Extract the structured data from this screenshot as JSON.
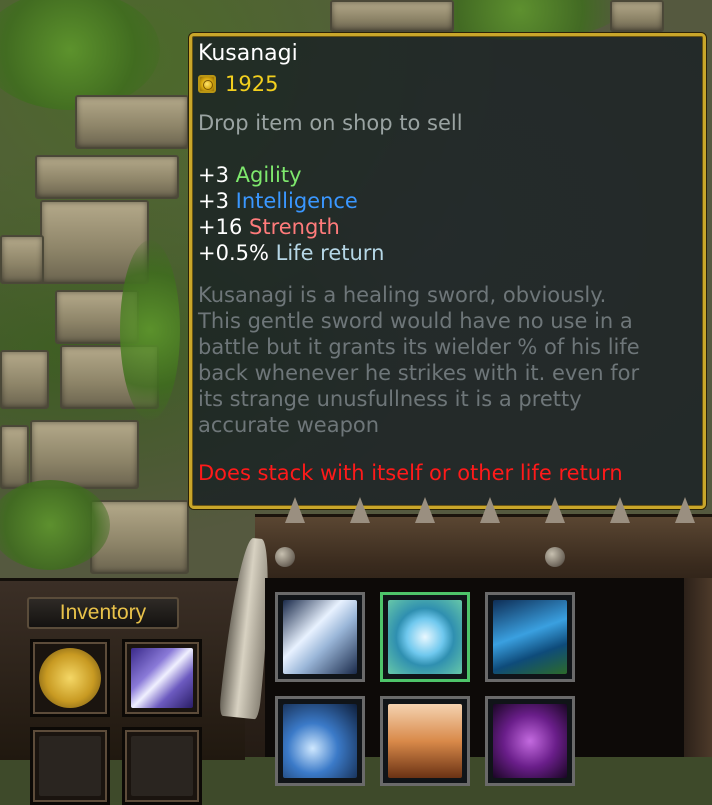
{
  "tooltip": {
    "title": "Kusanagi",
    "cost": "1925",
    "hint": "Drop item on shop to sell",
    "stats": [
      {
        "value": "+3",
        "name": "Agility"
      },
      {
        "value": "+3",
        "name": "Intelligence"
      },
      {
        "value": "+16",
        "name": "Strength"
      },
      {
        "value": "+0.5%",
        "name": "Life return"
      }
    ],
    "description": "Kusanagi is a  healing sword, obviously.\nThis gentle sword would have no use in a\nbattle but it grants its wielder % of his life\nback whenever he strikes with it. even for\nits strange unusfullness it is a pretty\naccurate weapon",
    "warning": "Does stack with itself or other life return"
  },
  "inventory": {
    "title": "Inventory",
    "slots": [
      {
        "icon": "gold-medallion-icon"
      },
      {
        "icon": "crystal-sword-icon"
      },
      {
        "icon": "empty-slot"
      },
      {
        "icon": "empty-slot"
      }
    ]
  },
  "commands": [
    {
      "icon": "white-blade-icon"
    },
    {
      "icon": "ice-ring-icon"
    },
    {
      "icon": "blue-crest-icon"
    },
    {
      "icon": "blue-swirl-icon"
    },
    {
      "icon": "fire-hammer-icon"
    },
    {
      "icon": "purple-orb-icon"
    }
  ],
  "colors": {
    "border_gold": "#c9a62a",
    "cost": "#f2cf1e",
    "agility": "#7ee86d",
    "intelligence": "#3a97ff",
    "strength": "#ff7b7b",
    "life": "#b6d7e6",
    "warning": "#ff1a1a"
  }
}
